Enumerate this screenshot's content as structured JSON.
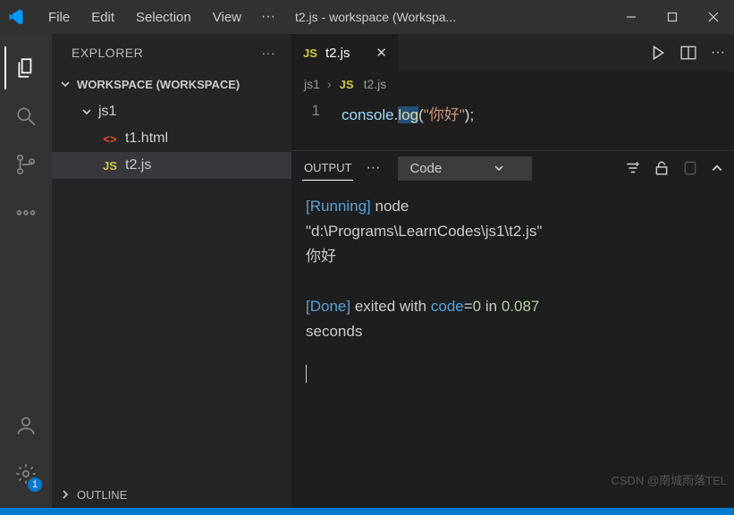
{
  "titlebar": {
    "menu": [
      "File",
      "Edit",
      "Selection",
      "View"
    ],
    "ellipsis": "···",
    "title": "t2.js - workspace (Workspa..."
  },
  "activitybar": {
    "gear_badge": "1"
  },
  "sidebar": {
    "header": "EXPLORER",
    "header_ellipsis": "···",
    "workspace_label": "WORKSPACE (WORKSPACE)",
    "folder1": "js1",
    "file1_icon": "<>",
    "file1": "t1.html",
    "file2_icon": "JS",
    "file2": "t2.js",
    "outline": "OUTLINE"
  },
  "tabs": {
    "active_icon": "JS",
    "active_label": "t2.js"
  },
  "breadcrumbs": {
    "seg1": "js1",
    "seg2_icon": "JS",
    "seg2": "t2.js"
  },
  "code": {
    "line_no": "1",
    "t_console": "console",
    "t_dot": ".",
    "t_log": "log",
    "t_lparen": "(",
    "t_str": "\"你好\"",
    "t_rparen": ")",
    "t_semi": ";"
  },
  "panel": {
    "tab_label": "OUTPUT",
    "ellipsis": "···",
    "dropdown": "Code"
  },
  "output": {
    "l1a": "[Running]",
    "l1b": " node ",
    "l2": "\"d:\\Programs\\LearnCodes\\js1\\t2.js\"",
    "l3": "你好",
    "l4a": "[Done]",
    "l4b": " exited with ",
    "l4c": "code",
    "l4d": "=",
    "l4e": "0",
    "l4f": " in ",
    "l4g": "0.087",
    "l5": "seconds"
  },
  "watermark": "CSDN @南城雨落TEL"
}
